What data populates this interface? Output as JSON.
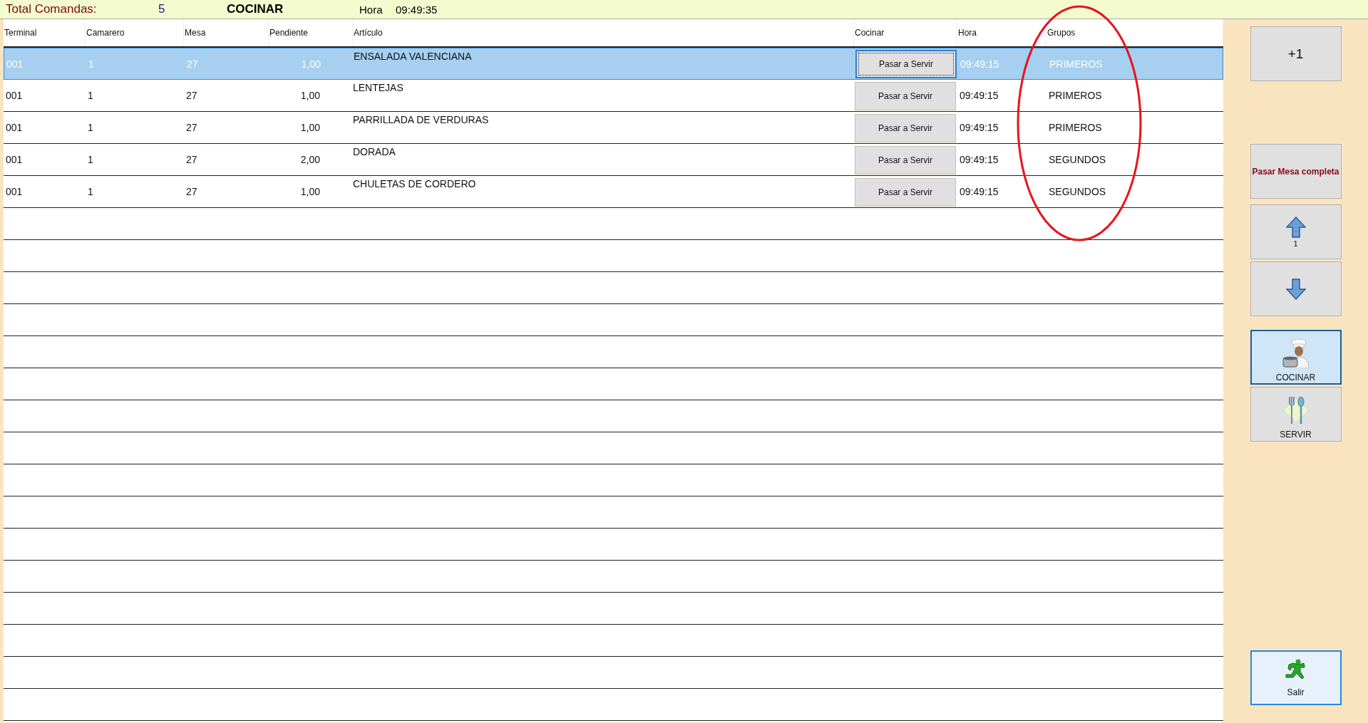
{
  "header": {
    "total_label": "Total Comandas:",
    "total": "5",
    "mode": "COCINAR",
    "time_label": "Hora",
    "time": "09:49:35"
  },
  "table": {
    "columns": [
      "Terminal",
      "Camarero",
      "Mesa",
      "Pendiente",
      "Artículo",
      "Cocinar",
      "Hora",
      "Grupos"
    ],
    "rows": [
      {
        "terminal": "001",
        "camarero": "1",
        "mesa": "27",
        "pendiente": "1,00",
        "articulo": "ENSALADA VALENCIANA",
        "action": "Pasar a Servir",
        "hora": "09:49:15",
        "grupo": "PRIMEROS",
        "selected": true
      },
      {
        "terminal": "001",
        "camarero": "1",
        "mesa": "27",
        "pendiente": "1,00",
        "articulo": "LENTEJAS",
        "action": "Pasar a Servir",
        "hora": "09:49:15",
        "grupo": "PRIMEROS",
        "selected": false
      },
      {
        "terminal": "001",
        "camarero": "1",
        "mesa": "27",
        "pendiente": "1,00",
        "articulo": "PARRILLADA DE VERDURAS",
        "action": "Pasar a Servir",
        "hora": "09:49:15",
        "grupo": "PRIMEROS",
        "selected": false
      },
      {
        "terminal": "001",
        "camarero": "1",
        "mesa": "27",
        "pendiente": "2,00",
        "articulo": "DORADA",
        "action": "Pasar a Servir",
        "hora": "09:49:15",
        "grupo": "SEGUNDOS",
        "selected": false
      },
      {
        "terminal": "001",
        "camarero": "1",
        "mesa": "27",
        "pendiente": "1,00",
        "articulo": "CHULETAS DE CORDERO",
        "action": "Pasar a Servir",
        "hora": "09:49:15",
        "grupo": "SEGUNDOS",
        "selected": false
      }
    ]
  },
  "side_panel": {
    "add_button": "+1",
    "complete_button": "Pasar Mesa completa",
    "page": "1",
    "modes": [
      {
        "label": "COCINAR",
        "kind": "cook",
        "selected": true
      },
      {
        "label": "SERVIR",
        "kind": "serve",
        "selected": false
      }
    ],
    "exit_button": "Salir"
  }
}
